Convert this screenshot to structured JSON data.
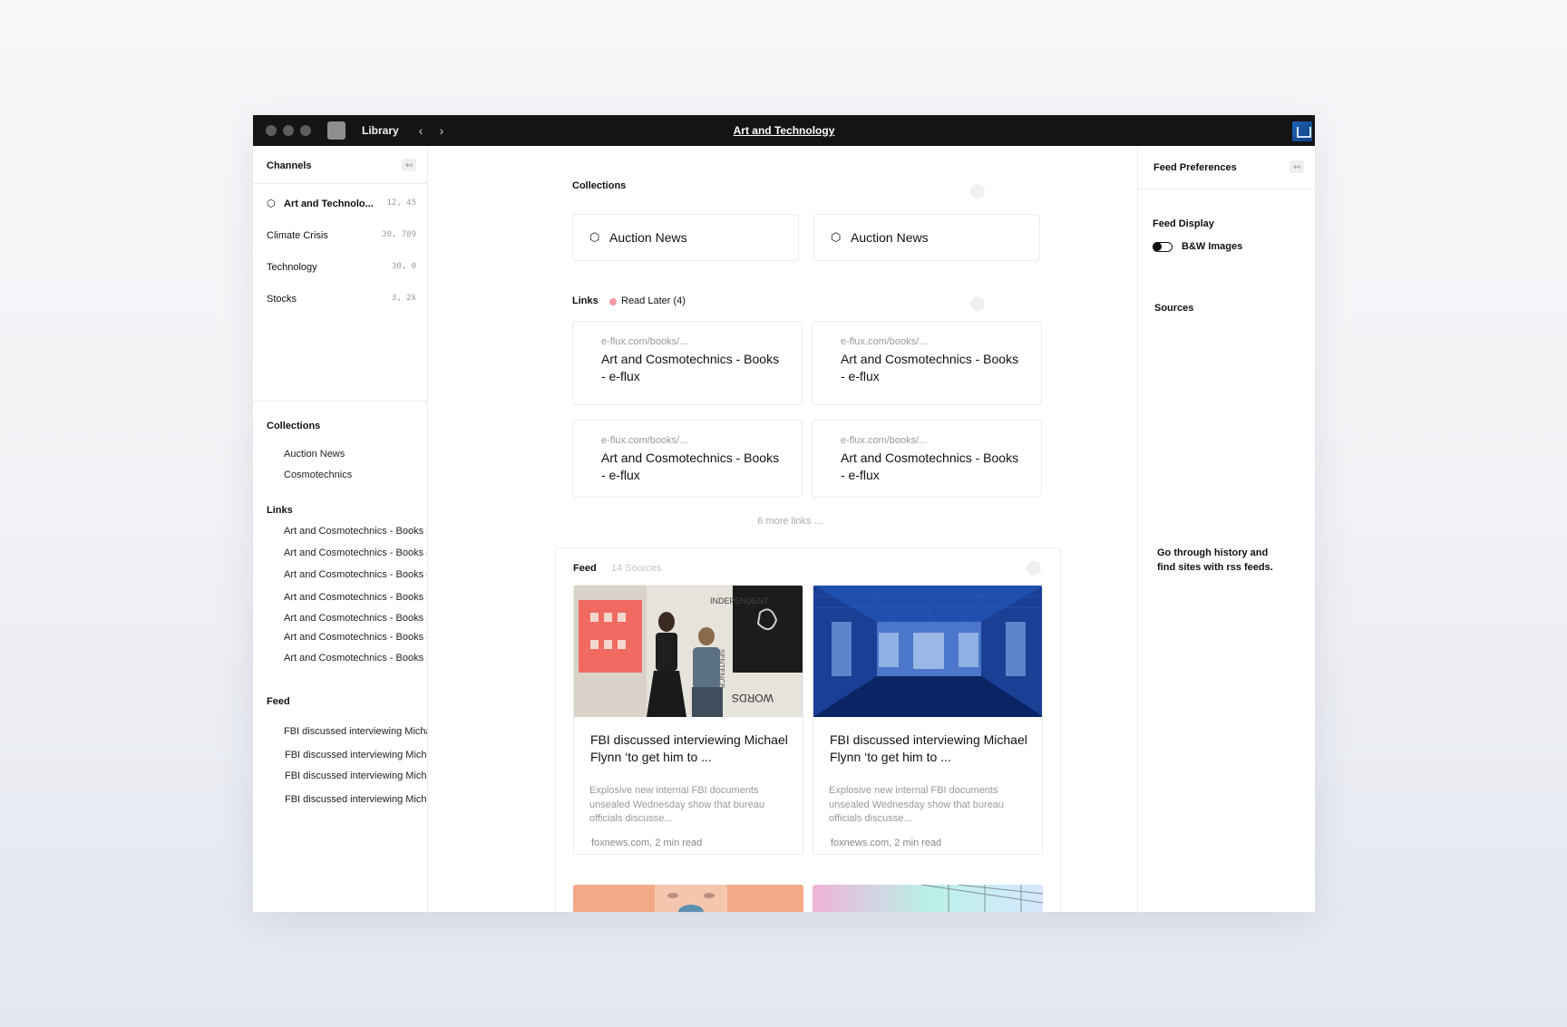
{
  "titlebar": {
    "library_label": "Library",
    "title": "Art and Technology",
    "back_icon": "chevron-left-icon",
    "forward_icon": "chevron-right-icon"
  },
  "sidebar": {
    "channels_heading": "Channels",
    "collapse_icon": "↤",
    "channels": [
      {
        "label": "Art and Technolo...",
        "count": "12, 45",
        "icon": "cube-icon"
      },
      {
        "label": "Climate Crisis",
        "count": "30, 789"
      },
      {
        "label": "Technology",
        "count": "30, 0"
      },
      {
        "label": "Stocks",
        "count": "3, 2k"
      }
    ],
    "collections_heading": "Collections",
    "collections": [
      "Auction News",
      "Cosmotechnics"
    ],
    "links_heading": "Links",
    "links": [
      "Art and Cosmotechnics - Books - e-flux",
      "Art and Cosmotechnics - Books - e-flux",
      "Art and Cosmotechnics - Books - e-flux",
      "Art and Cosmotechnics - Books - e-flux",
      "Art and Cosmotechnics - Books - e-flux",
      "Art and Cosmotechnics - Books - e-flux",
      "Art and Cosmotechnics - Books - e-flux"
    ],
    "feed_heading": "Feed",
    "feed": [
      "FBI discussed interviewing Michael Flynn",
      "FBI discussed interviewing Michael Flynn",
      "FBI discussed interviewing Michael Flynn",
      "FBI discussed interviewing Michael Flynn"
    ]
  },
  "main": {
    "collections_heading": "Collections",
    "collection_cards": [
      "Auction News",
      "Auction News"
    ],
    "links_heading": "Links",
    "read_later_label": "Read Later (4)",
    "link_cards": [
      {
        "url": "e-flux.com/books/...",
        "title": "Art and Cosmotechnics - Books - e-flux"
      },
      {
        "url": "e-flux.com/books/...",
        "title": "Art and Cosmotechnics - Books - e-flux"
      },
      {
        "url": "e-flux.com/books/...",
        "title": "Art and Cosmotechnics - Books - e-flux"
      },
      {
        "url": "e-flux.com/books/...",
        "title": "Art and Cosmotechnics - Books - e-flux"
      }
    ],
    "more_links": "6 more links ...",
    "feed_heading": "Feed",
    "feed_sources": "14 Sources",
    "feed_cards": [
      {
        "title": "FBI discussed interviewing Michael Flynn ‘to get him to ...",
        "description": "Explosive new internal FBI documents unsealed Wednesday show that bureau officials discusse...",
        "meta": "foxnews.com, 2 min read"
      },
      {
        "title": "FBI discussed interviewing Michael Flynn ‘to get him to ...",
        "description": "Explosive new internal FBI documents unsealed Wednesday show that bureau officials discusse...",
        "meta": "foxnews.com, 2 min read"
      }
    ]
  },
  "right_panel": {
    "heading": "Feed Preferences",
    "feed_display_label": "Feed Display",
    "bw_images_label": "B&W Images",
    "bw_images_enabled": false,
    "sources_label": "Sources",
    "hint": "Go through history and find sites with rss feeds."
  },
  "colors": {
    "titlebar_bg": "#141414",
    "read_later_dot": "#f29aa6",
    "border": "#ececec"
  }
}
